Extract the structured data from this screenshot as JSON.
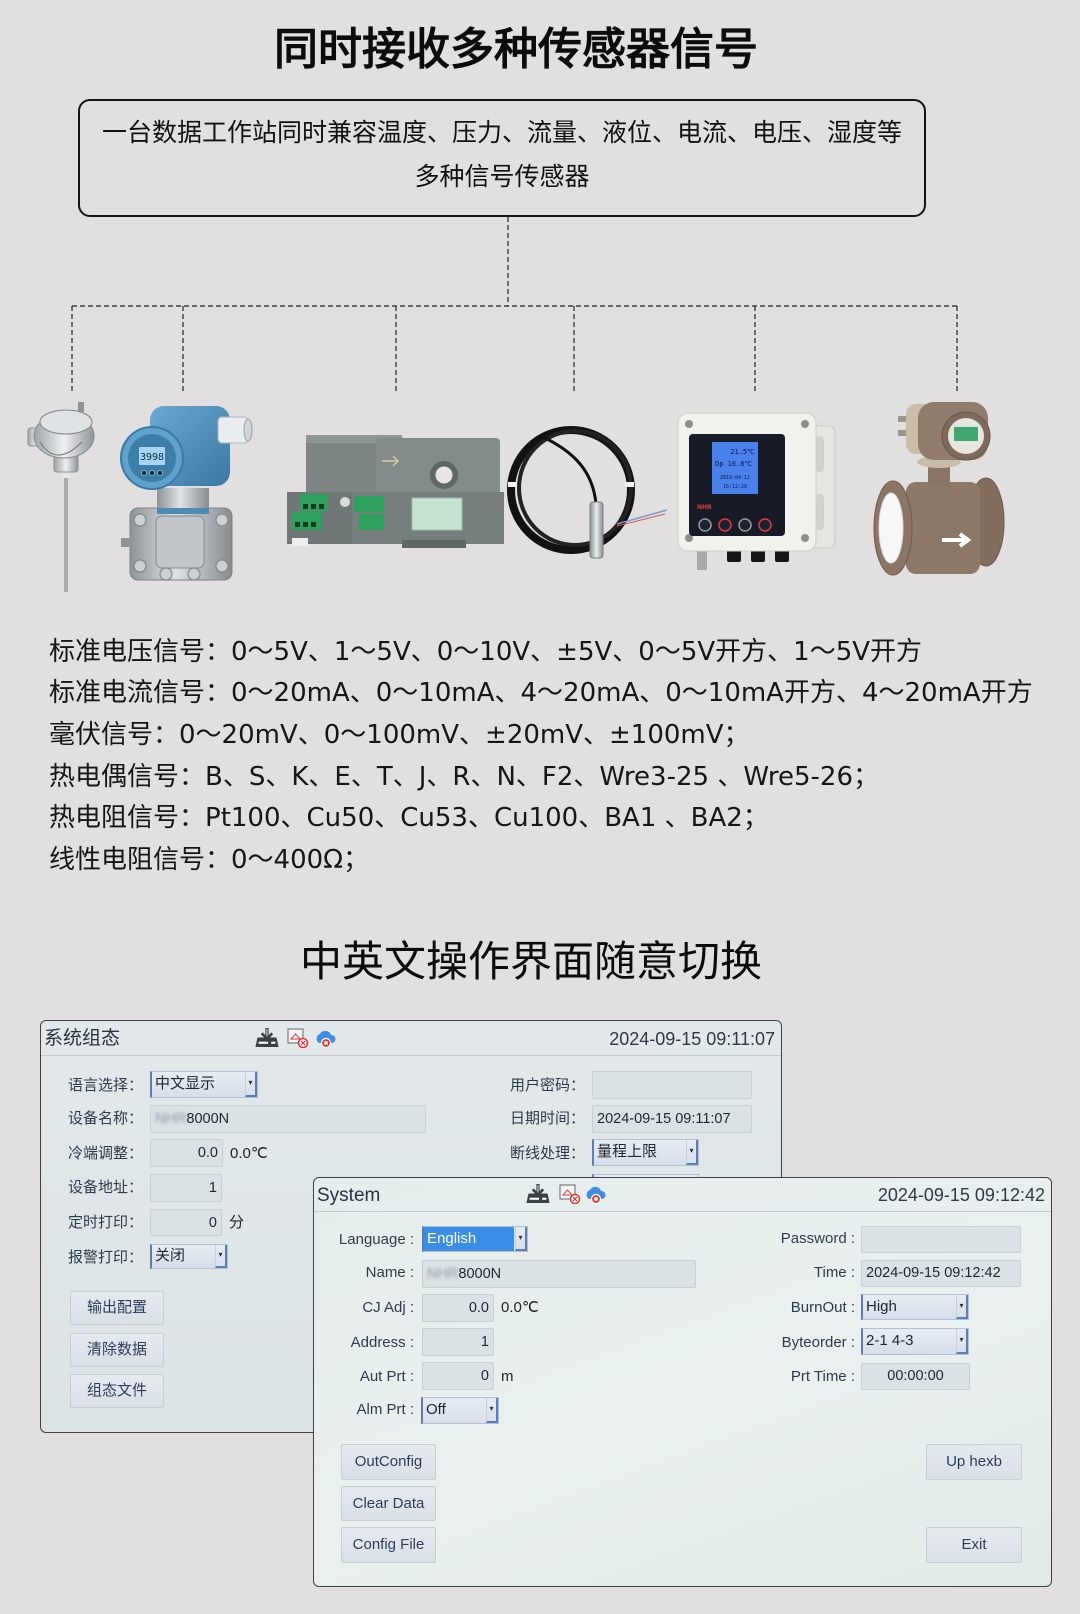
{
  "header": {
    "title": "同时接收多种传感器信号"
  },
  "intro_box": {
    "lines": [
      "一台数据工作站同时兼容温度、压力、流量、液位、电流、电压、湿度等",
      "多种信号传感器"
    ]
  },
  "sensors": [
    {
      "type": "thermocouple"
    },
    {
      "type": "pressure-transmitter",
      "display": "3998"
    },
    {
      "type": "current-sensor"
    },
    {
      "type": "level-sensor"
    },
    {
      "type": "temperature-humidity-display",
      "brand": "NHR",
      "display": [
        "21.5℃",
        "Dp 16.8℃",
        "2019-04-12",
        "16:12:28"
      ]
    },
    {
      "type": "electromagnetic-flowmeter"
    }
  ],
  "specs": {
    "lines": [
      {
        "label": "标准电压信号：",
        "value": "0～5V、1～5V、0～10V、±5V、0～5V开方、1～5V开方"
      },
      {
        "label": "标准电流信号：",
        "value": "0～20mA、0～10mA、4～20mA、0～10mA开方、4～20mA开方"
      },
      {
        "label": "毫伏信号：",
        "value": "0～20mV、0～100mV、±20mV、±100mV；"
      },
      {
        "label": "热电偶信号：",
        "value": "B、S、K、E、T、J、R、N、F2、Wre3-25 、Wre5-26；"
      },
      {
        "label": "热电阻信号：",
        "value": "Pt100、Cu50、Cu53、Cu100、BA1 、BA2；"
      },
      {
        "label": "线性电阻信号：",
        "value": "0～400Ω；"
      }
    ]
  },
  "section2": {
    "title": "中英文操作界面随意切换"
  },
  "cn_panel": {
    "title": "系统组态",
    "timestamp": "2024-09-15 09:11:07",
    "icons": [
      "save-to-drive-icon",
      "print-error-icon",
      "cloud-offline-icon"
    ],
    "fields_left": [
      {
        "label": "语言选择：",
        "type": "select",
        "value": "中文显示"
      },
      {
        "label": "设备名称：",
        "type": "text",
        "value_blurred": "NHR",
        "value": "8000N"
      },
      {
        "label": "冷端调整：",
        "type": "number",
        "value": "0.0",
        "unit": "0.0℃"
      },
      {
        "label": "设备地址：",
        "type": "number",
        "value": "1"
      },
      {
        "label": "定时打印：",
        "type": "number",
        "value": "0",
        "unit": "分"
      },
      {
        "label": "报警打印：",
        "type": "select",
        "value": "关闭"
      }
    ],
    "fields_right": [
      {
        "label": "用户密码：",
        "type": "password",
        "value": ""
      },
      {
        "label": "日期时间：",
        "type": "text",
        "value": "2024-09-15 09:11:07"
      },
      {
        "label": "断线处理：",
        "type": "select",
        "value": "量程上限"
      }
    ],
    "buttons": [
      "输出配置",
      "清除数据",
      "组态文件"
    ]
  },
  "en_panel": {
    "title": "System",
    "timestamp": "2024-09-15 09:12:42",
    "icons": [
      "save-to-drive-icon",
      "print-error-icon",
      "cloud-offline-icon"
    ],
    "fields_left": [
      {
        "label": "Language :",
        "type": "select",
        "value": "English",
        "selected": true
      },
      {
        "label": "Name :",
        "type": "text",
        "value_blurred": "NHR",
        "value": "8000N"
      },
      {
        "label": "CJ Adj :",
        "type": "number",
        "value": "0.0",
        "unit": "0.0℃"
      },
      {
        "label": "Address :",
        "type": "number",
        "value": "1"
      },
      {
        "label": "Aut Prt :",
        "type": "number",
        "value": "0",
        "unit": "m"
      },
      {
        "label": "Alm Prt :",
        "type": "select",
        "value": "Off"
      }
    ],
    "fields_right": [
      {
        "label": "Password :",
        "type": "password",
        "value": ""
      },
      {
        "label": "Time :",
        "type": "text",
        "value": "2024-09-15 09:12:42"
      },
      {
        "label": "BurnOut :",
        "type": "select",
        "value": "High"
      },
      {
        "label": "Byteorder :",
        "type": "select",
        "value": "2-1 4-3"
      },
      {
        "label": "Prt Time :",
        "type": "text",
        "value": "00:00:00"
      }
    ],
    "buttons_left": [
      "OutConfig",
      "Clear Data",
      "Config File"
    ],
    "buttons_right": [
      "Up hexb",
      "Exit"
    ]
  },
  "colors": {
    "page_background": "#e1dfe0",
    "text": "#111111",
    "selection_highlight": "#3b8ee6",
    "select_border": "#5d7eb3",
    "panel_label": "#2e3b4c",
    "button_text": "#2c3d5a",
    "error_badge": "#dd3333",
    "cloud": "#3f8ee0"
  }
}
